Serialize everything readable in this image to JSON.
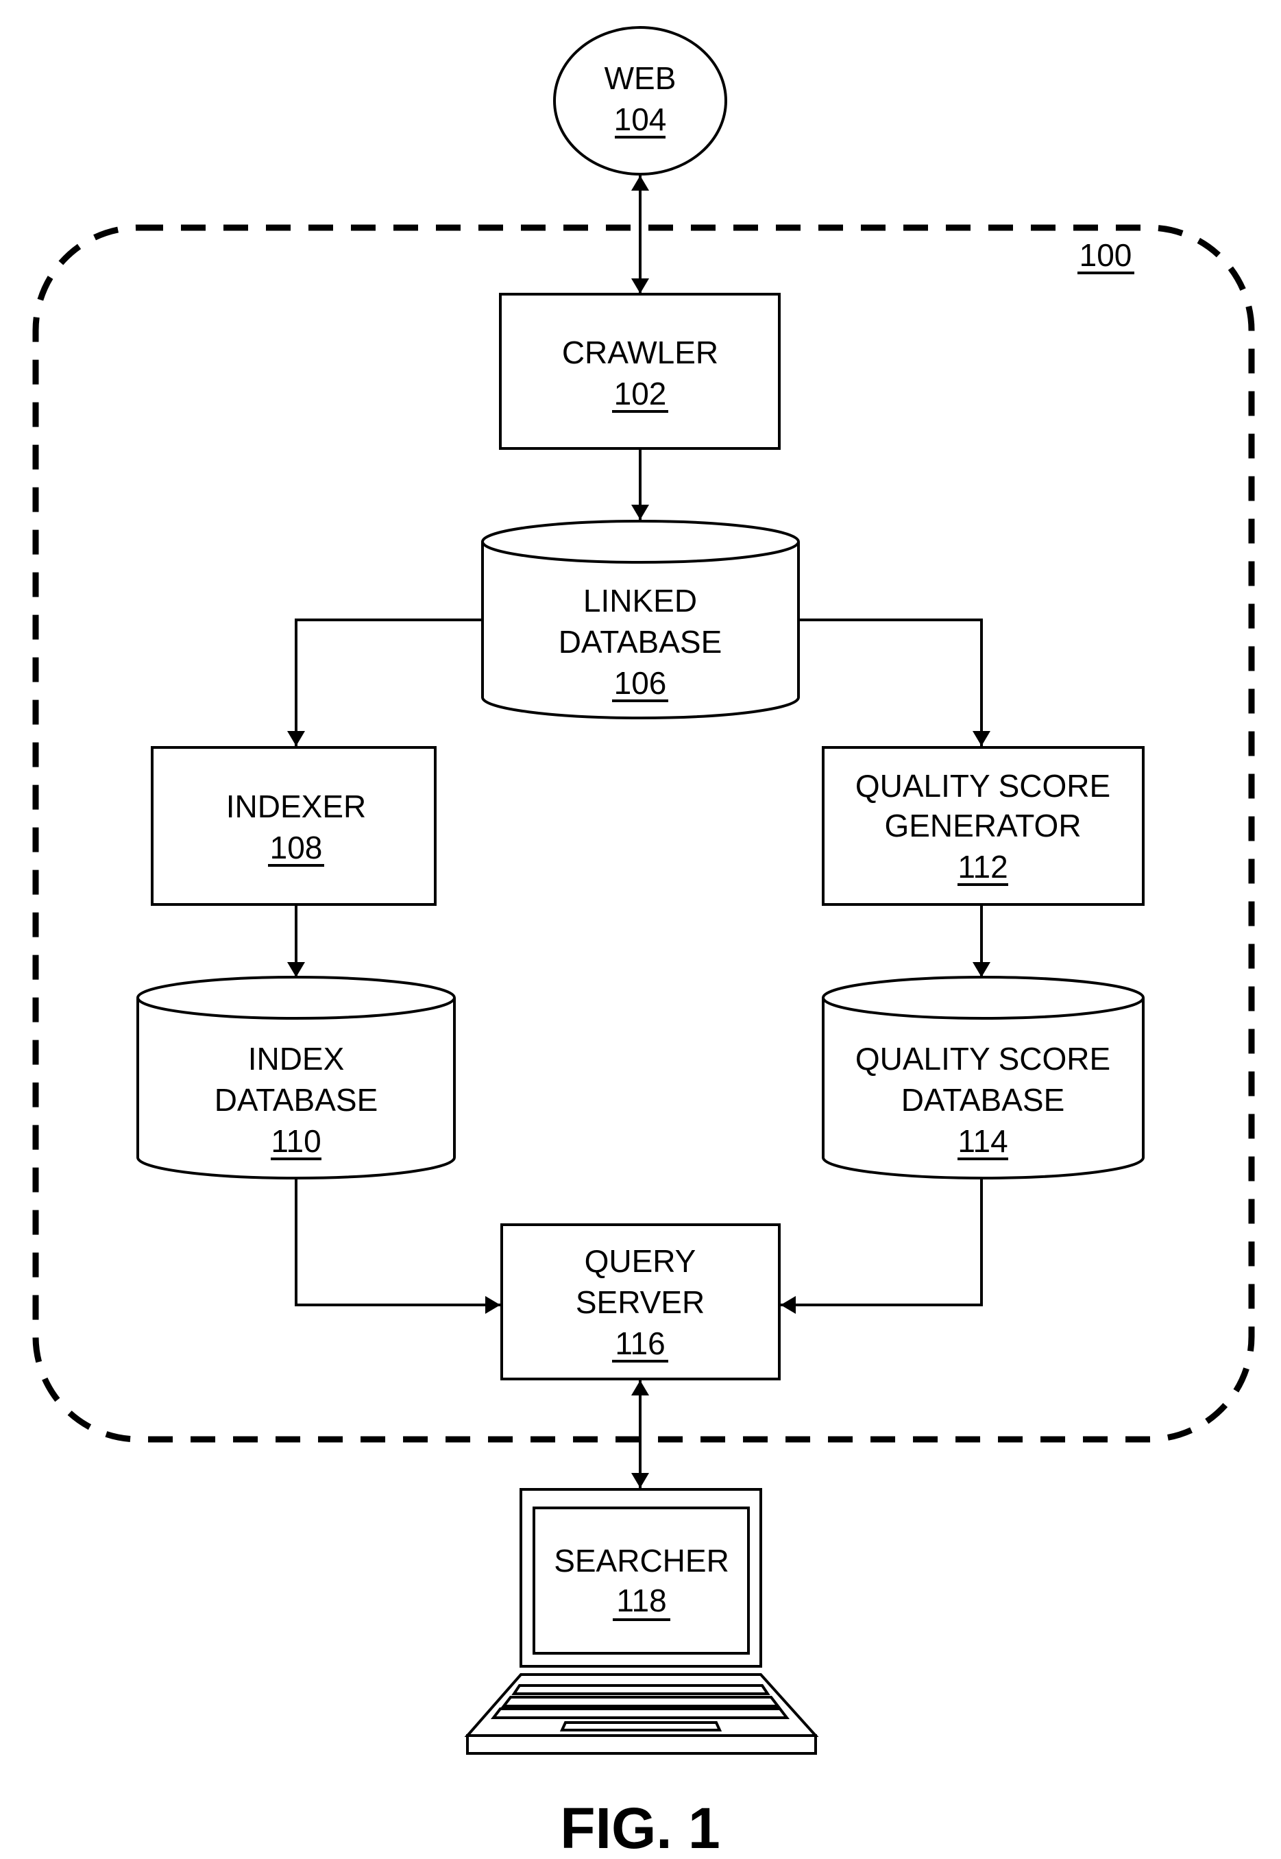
{
  "figure_label": "FIG. 1",
  "system": {
    "ref": "100"
  },
  "nodes": {
    "web": {
      "name": "WEB",
      "ref": "104",
      "shape": "ellipse"
    },
    "crawler": {
      "name": "CRAWLER",
      "ref": "102",
      "shape": "box"
    },
    "linked_db": {
      "line1": "LINKED",
      "line2": "DATABASE",
      "ref": "106",
      "shape": "cylinder"
    },
    "indexer": {
      "name": "INDEXER",
      "ref": "108",
      "shape": "box"
    },
    "qsg": {
      "line1": "QUALITY SCORE",
      "line2": "GENERATOR",
      "ref": "112",
      "shape": "box"
    },
    "index_db": {
      "line1": "INDEX",
      "line2": "DATABASE",
      "ref": "110",
      "shape": "cylinder"
    },
    "qs_db": {
      "line1": "QUALITY SCORE",
      "line2": "DATABASE",
      "ref": "114",
      "shape": "cylinder"
    },
    "query_server": {
      "line1": "QUERY",
      "line2": "SERVER",
      "ref": "116",
      "shape": "box"
    },
    "searcher": {
      "name": "SEARCHER",
      "ref": "118",
      "shape": "laptop"
    }
  },
  "edges": [
    {
      "from": "web",
      "to": "crawler",
      "bidirectional": true
    },
    {
      "from": "crawler",
      "to": "linked_db",
      "bidirectional": false
    },
    {
      "from": "linked_db",
      "to": "indexer",
      "bidirectional": false
    },
    {
      "from": "linked_db",
      "to": "qsg",
      "bidirectional": false
    },
    {
      "from": "indexer",
      "to": "index_db",
      "bidirectional": false
    },
    {
      "from": "qsg",
      "to": "qs_db",
      "bidirectional": false
    },
    {
      "from": "index_db",
      "to": "query_server",
      "bidirectional": false
    },
    {
      "from": "qs_db",
      "to": "query_server",
      "bidirectional": false
    },
    {
      "from": "query_server",
      "to": "searcher",
      "bidirectional": true
    }
  ]
}
